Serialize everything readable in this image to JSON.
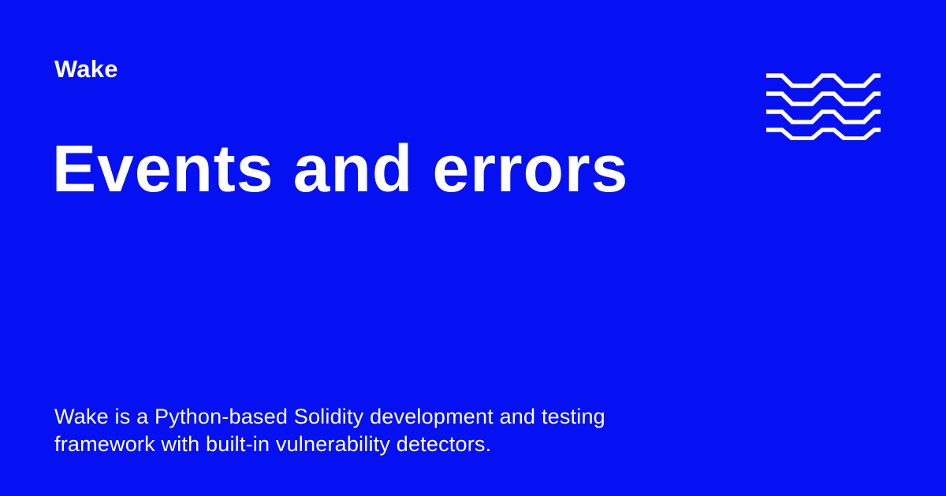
{
  "brand": {
    "name": "Wake",
    "logo_icon": "wake-wave-logo-icon",
    "background_color": "#0511f2",
    "text_color": "#ffffff"
  },
  "page": {
    "title": "Events and errors",
    "description": "Wake is a Python-based Solidity development and testing framework with built-in vulnerability detectors."
  }
}
